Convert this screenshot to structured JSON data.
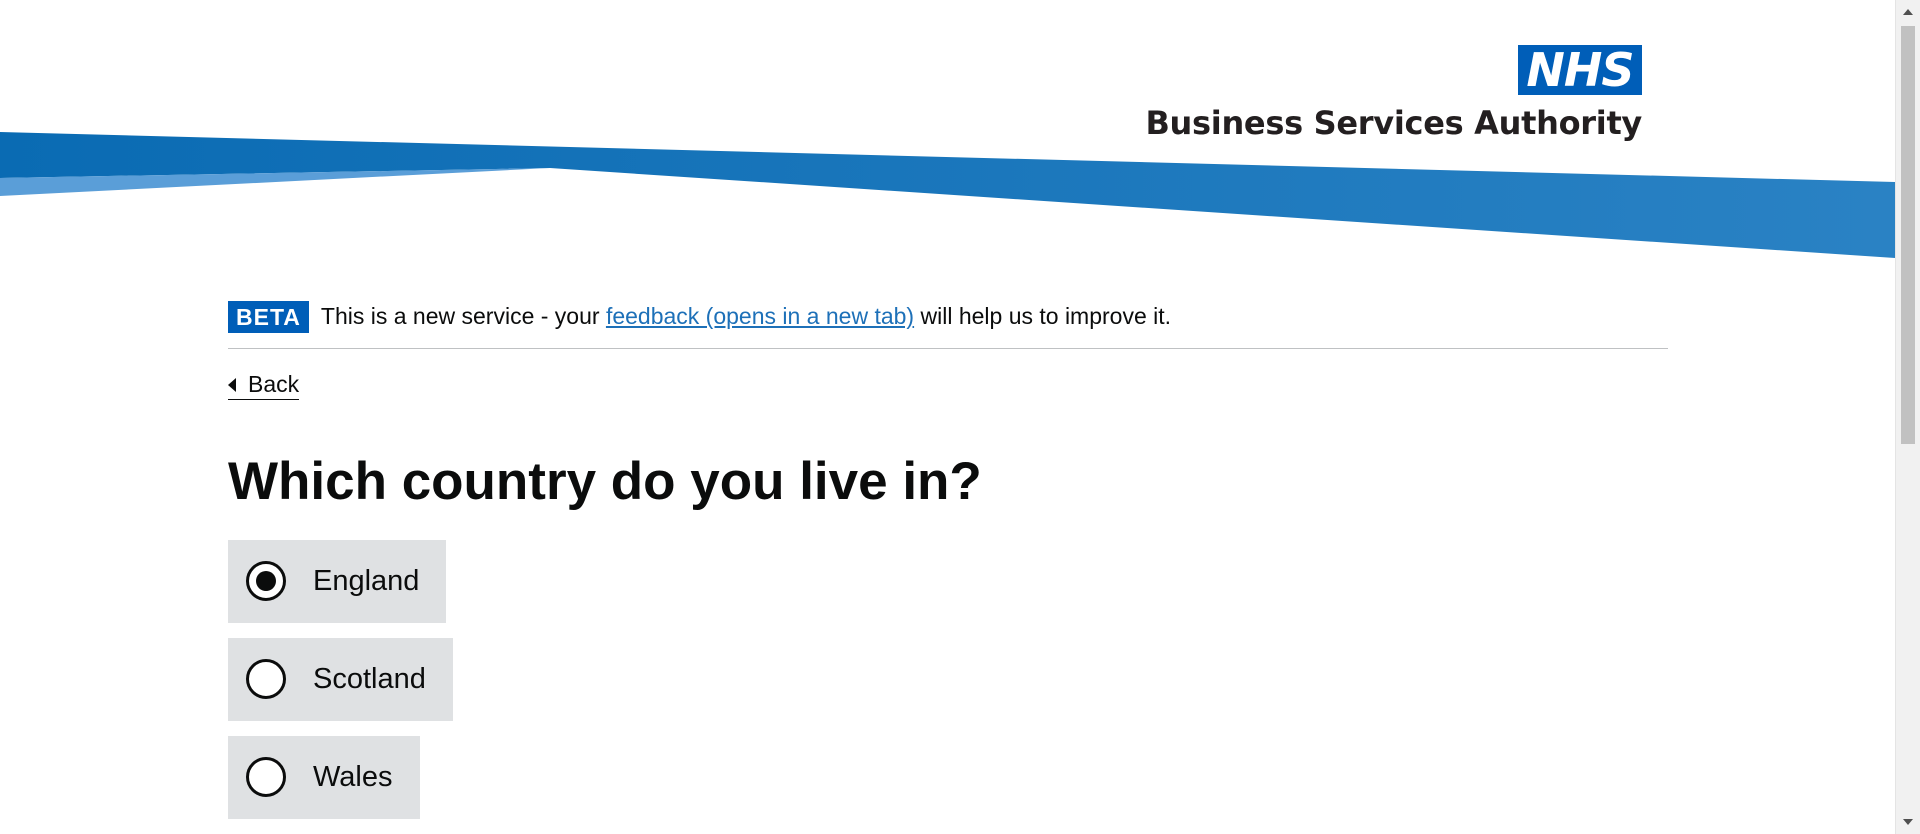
{
  "header": {
    "logo_mark": "NHS",
    "org_name": "Business Services Authority"
  },
  "beta_banner": {
    "tag": "BETA",
    "text_before": "This is a new service - your ",
    "link_text": "feedback (opens in a new tab)",
    "text_after": " will help us to improve it."
  },
  "back_link": {
    "label": "Back"
  },
  "question": {
    "title": "Which country do you live in?"
  },
  "options": [
    {
      "label": "England",
      "selected": true
    },
    {
      "label": "Scotland",
      "selected": false
    },
    {
      "label": "Wales",
      "selected": false
    }
  ],
  "colors": {
    "nhs_blue": "#005eb8",
    "swoosh_dark": "#0072c6",
    "swoosh_light": "#41b6e6",
    "radio_bg": "#dfe1e3",
    "link": "#1d70b8"
  }
}
